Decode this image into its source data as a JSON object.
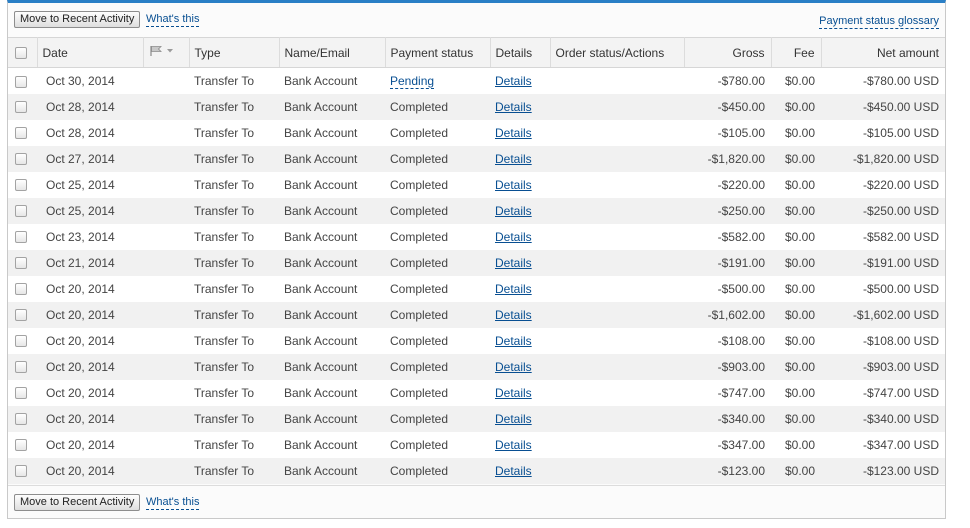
{
  "toolbar_top": {
    "move_button": "Move to Recent Activity",
    "help_link": "What's this",
    "glossary_link": "Payment status glossary"
  },
  "toolbar_bottom": {
    "move_button": "Move to Recent Activity",
    "help_link": "What's this"
  },
  "columns": {
    "date": "Date",
    "type": "Type",
    "name_email": "Name/Email",
    "payment_status": "Payment status",
    "details": "Details",
    "order_status": "Order status/Actions",
    "gross": "Gross",
    "fee": "Fee",
    "net_amount": "Net amount"
  },
  "colors": {
    "accent": "#2a7fc6",
    "link": "#084f92"
  },
  "rows": [
    {
      "date": "Oct 30, 2014",
      "type": "Transfer To",
      "name": "Bank Account",
      "status": "Pending",
      "details": "Details",
      "gross": "-$780.00",
      "fee": "$0.00",
      "net": "-$780.00 USD"
    },
    {
      "date": "Oct 28, 2014",
      "type": "Transfer To",
      "name": "Bank Account",
      "status": "Completed",
      "details": "Details",
      "gross": "-$450.00",
      "fee": "$0.00",
      "net": "-$450.00 USD"
    },
    {
      "date": "Oct 28, 2014",
      "type": "Transfer To",
      "name": "Bank Account",
      "status": "Completed",
      "details": "Details",
      "gross": "-$105.00",
      "fee": "$0.00",
      "net": "-$105.00 USD"
    },
    {
      "date": "Oct 27, 2014",
      "type": "Transfer To",
      "name": "Bank Account",
      "status": "Completed",
      "details": "Details",
      "gross": "-$1,820.00",
      "fee": "$0.00",
      "net": "-$1,820.00 USD"
    },
    {
      "date": "Oct 25, 2014",
      "type": "Transfer To",
      "name": "Bank Account",
      "status": "Completed",
      "details": "Details",
      "gross": "-$220.00",
      "fee": "$0.00",
      "net": "-$220.00 USD"
    },
    {
      "date": "Oct 25, 2014",
      "type": "Transfer To",
      "name": "Bank Account",
      "status": "Completed",
      "details": "Details",
      "gross": "-$250.00",
      "fee": "$0.00",
      "net": "-$250.00 USD"
    },
    {
      "date": "Oct 23, 2014",
      "type": "Transfer To",
      "name": "Bank Account",
      "status": "Completed",
      "details": "Details",
      "gross": "-$582.00",
      "fee": "$0.00",
      "net": "-$582.00 USD"
    },
    {
      "date": "Oct 21, 2014",
      "type": "Transfer To",
      "name": "Bank Account",
      "status": "Completed",
      "details": "Details",
      "gross": "-$191.00",
      "fee": "$0.00",
      "net": "-$191.00 USD"
    },
    {
      "date": "Oct 20, 2014",
      "type": "Transfer To",
      "name": "Bank Account",
      "status": "Completed",
      "details": "Details",
      "gross": "-$500.00",
      "fee": "$0.00",
      "net": "-$500.00 USD"
    },
    {
      "date": "Oct 20, 2014",
      "type": "Transfer To",
      "name": "Bank Account",
      "status": "Completed",
      "details": "Details",
      "gross": "-$1,602.00",
      "fee": "$0.00",
      "net": "-$1,602.00 USD"
    },
    {
      "date": "Oct 20, 2014",
      "type": "Transfer To",
      "name": "Bank Account",
      "status": "Completed",
      "details": "Details",
      "gross": "-$108.00",
      "fee": "$0.00",
      "net": "-$108.00 USD"
    },
    {
      "date": "Oct 20, 2014",
      "type": "Transfer To",
      "name": "Bank Account",
      "status": "Completed",
      "details": "Details",
      "gross": "-$903.00",
      "fee": "$0.00",
      "net": "-$903.00 USD"
    },
    {
      "date": "Oct 20, 2014",
      "type": "Transfer To",
      "name": "Bank Account",
      "status": "Completed",
      "details": "Details",
      "gross": "-$747.00",
      "fee": "$0.00",
      "net": "-$747.00 USD"
    },
    {
      "date": "Oct 20, 2014",
      "type": "Transfer To",
      "name": "Bank Account",
      "status": "Completed",
      "details": "Details",
      "gross": "-$340.00",
      "fee": "$0.00",
      "net": "-$340.00 USD"
    },
    {
      "date": "Oct 20, 2014",
      "type": "Transfer To",
      "name": "Bank Account",
      "status": "Completed",
      "details": "Details",
      "gross": "-$347.00",
      "fee": "$0.00",
      "net": "-$347.00 USD"
    },
    {
      "date": "Oct 20, 2014",
      "type": "Transfer To",
      "name": "Bank Account",
      "status": "Completed",
      "details": "Details",
      "gross": "-$123.00",
      "fee": "$0.00",
      "net": "-$123.00 USD"
    }
  ]
}
